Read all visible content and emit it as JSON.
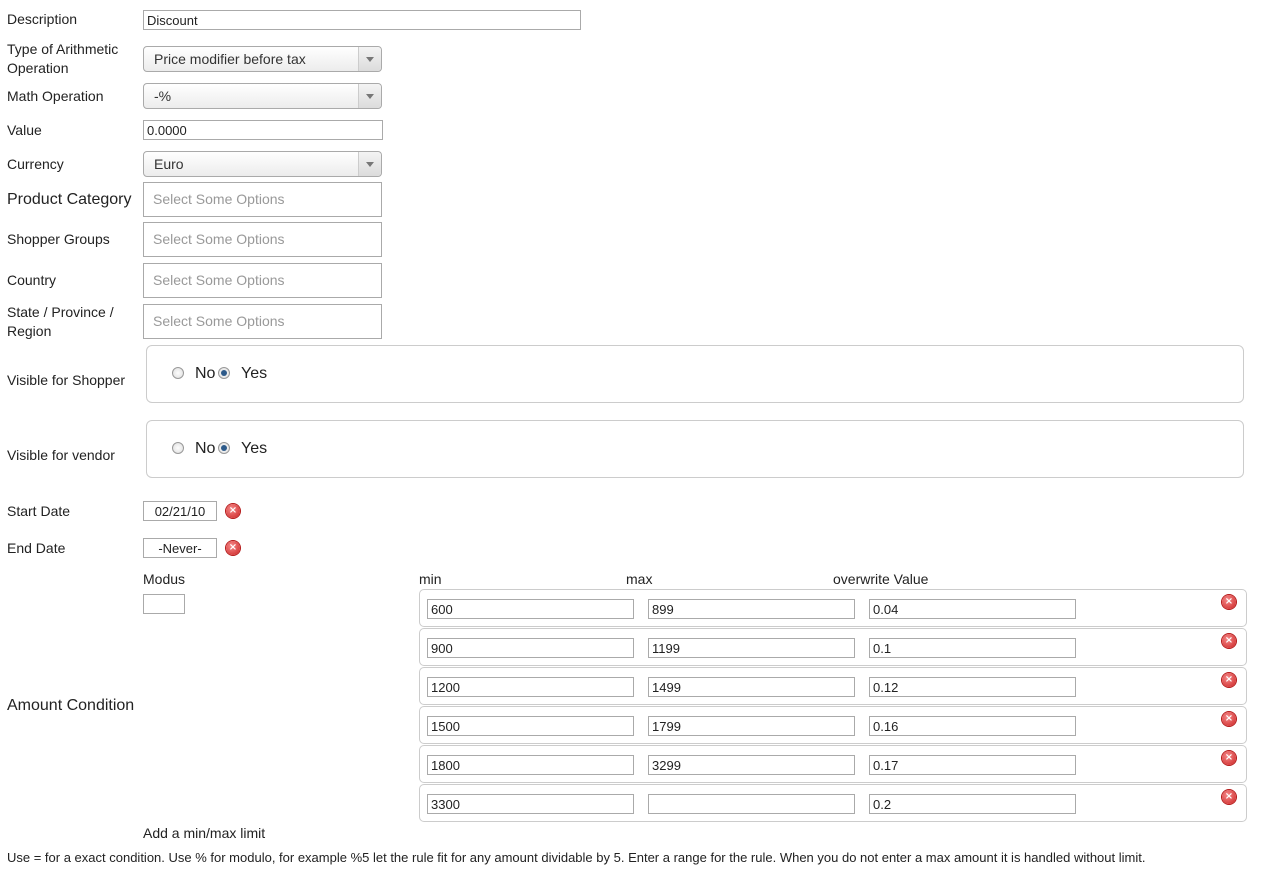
{
  "form": {
    "description": {
      "label": "Description",
      "value": "Discount"
    },
    "arith_type": {
      "label": "Type of Arithmetic Operation",
      "value": "Price modifier before tax"
    },
    "math_op": {
      "label": "Math Operation",
      "value": "-%"
    },
    "value": {
      "label": "Value",
      "value": "0.0000"
    },
    "currency": {
      "label": "Currency",
      "value": "Euro"
    },
    "product_category": {
      "label": "Product Category",
      "placeholder": "Select Some Options"
    },
    "shopper_groups": {
      "label": "Shopper Groups",
      "placeholder": "Select Some Options"
    },
    "country": {
      "label": "Country",
      "placeholder": "Select Some Options"
    },
    "state": {
      "label": "State / Province / Region",
      "placeholder": "Select Some Options"
    },
    "visible_shopper": {
      "label": "Visible for Shopper",
      "no": "No",
      "yes": "Yes",
      "selected": "Yes"
    },
    "visible_vendor": {
      "label": "Visible for vendor",
      "no": "No",
      "yes": "Yes",
      "selected": "Yes"
    },
    "start_date": {
      "label": "Start Date",
      "value": "02/21/10"
    },
    "end_date": {
      "label": "End Date",
      "value": "-Never-"
    }
  },
  "amount_condition": {
    "label": "Amount Condition",
    "modus_label": "Modus",
    "modus_value": "",
    "headers": {
      "min": "min",
      "max": "max",
      "overwrite": "overwrite Value"
    },
    "rows": [
      {
        "min": "600",
        "max": "899",
        "overwrite": "0.04"
      },
      {
        "min": "900",
        "max": "1199",
        "overwrite": "0.1"
      },
      {
        "min": "1200",
        "max": "1499",
        "overwrite": "0.12"
      },
      {
        "min": "1500",
        "max": "1799",
        "overwrite": "0.16"
      },
      {
        "min": "1800",
        "max": "3299",
        "overwrite": "0.17"
      },
      {
        "min": "3300",
        "max": "",
        "overwrite": "0.2"
      }
    ],
    "add_link": "Add a min/max limit",
    "help": "Use = for a exact condition. Use % for modulo, for example %5 let the rule fit for any amount dividable by 5. Enter a range for the rule. When you do not enter a max amount it is handled without limit."
  },
  "icons": {
    "delete": "remove-circle-icon",
    "dropdown": "chevron-down-icon"
  },
  "colors": {
    "delete": "#cc2222",
    "radio_selected": "#2d5a8a",
    "border": "#aaaaaa"
  }
}
